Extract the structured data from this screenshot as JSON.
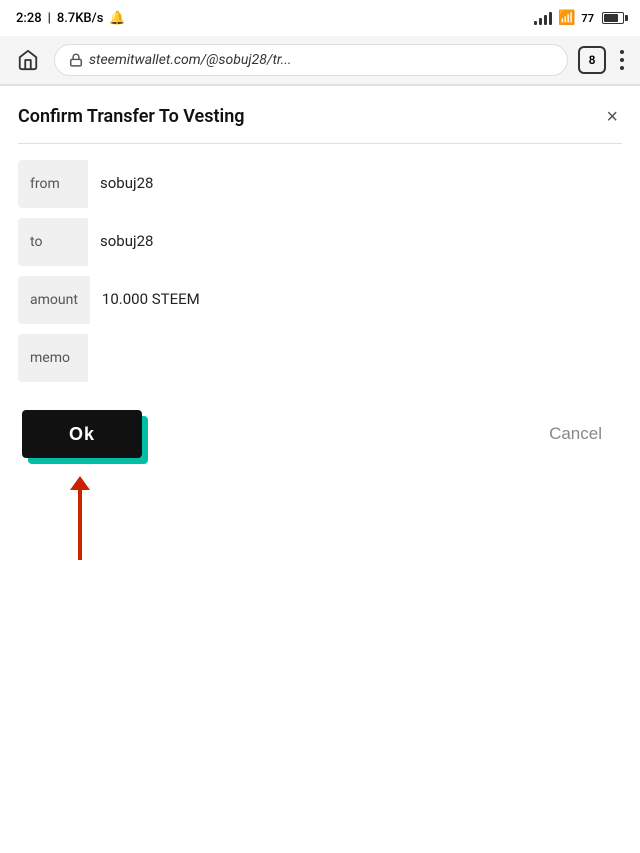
{
  "statusBar": {
    "time": "2:28",
    "network": "8.7KB/s",
    "battery": "77"
  },
  "browserBar": {
    "address": "steemitwallet.com/@sobuj28/tr...",
    "tabs": "8"
  },
  "dialog": {
    "title": "Confirm Transfer To Vesting",
    "fields": {
      "from_label": "from",
      "from_value": "sobuj28",
      "to_label": "to",
      "to_value": "sobuj28",
      "amount_label": "amount",
      "amount_value": "10.000 STEEM",
      "memo_label": "memo",
      "memo_value": ""
    },
    "ok_button": "Ok",
    "cancel_button": "Cancel"
  }
}
